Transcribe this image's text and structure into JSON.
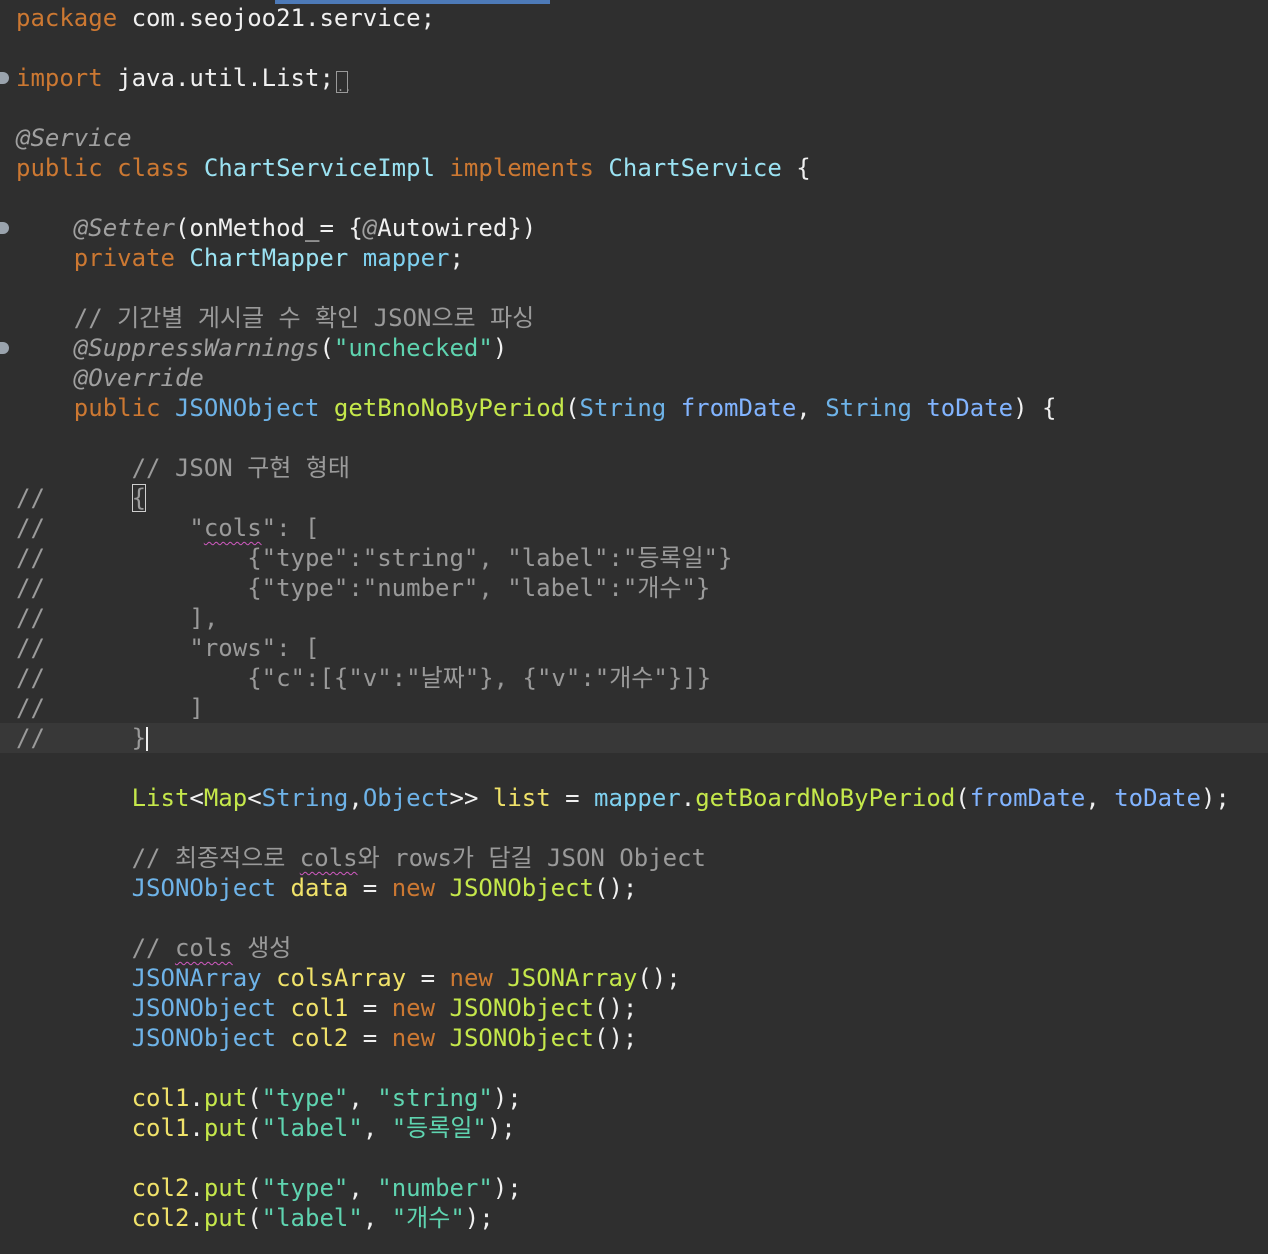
{
  "editor": {
    "language": "Java",
    "gutter_markers": [
      {
        "line": 3,
        "kind": "expand"
      },
      {
        "line": 8,
        "kind": "collapse"
      },
      {
        "line": 12,
        "kind": "collapse"
      }
    ],
    "lines": [
      [
        [
          "kw",
          "package"
        ],
        [
          "p",
          " com.seojoo21.service;"
        ]
      ],
      [],
      [
        [
          "kw",
          "import"
        ],
        [
          "p",
          " java.util.List;"
        ],
        [
          "fold",
          ".."
        ]
      ],
      [],
      [
        [
          "ann",
          "@Service"
        ]
      ],
      [
        [
          "kw",
          "public class "
        ],
        [
          "cls",
          "ChartServiceImpl"
        ],
        [
          "kw",
          " implements "
        ],
        [
          "cls",
          "ChartService"
        ],
        [
          "p",
          " {"
        ]
      ],
      [],
      [
        [
          "p",
          "    "
        ],
        [
          "ann",
          "@Setter"
        ],
        [
          "p",
          "(onMethod_= {"
        ],
        [
          "ann",
          "@"
        ],
        [
          "p",
          "Autowired})"
        ]
      ],
      [
        [
          "p",
          "    "
        ],
        [
          "kw",
          "private "
        ],
        [
          "cls",
          "ChartMapper"
        ],
        [
          "p",
          " "
        ],
        [
          "fld",
          "mapper"
        ],
        [
          "p",
          ";"
        ]
      ],
      [],
      [
        [
          "p",
          "    "
        ],
        [
          "cm",
          "// 기간별 게시글 수 확인 JSON으로 파싱"
        ]
      ],
      [
        [
          "p",
          "    "
        ],
        [
          "ann",
          "@SuppressWarnings"
        ],
        [
          "p",
          "("
        ],
        [
          "str",
          "\"unchecked\""
        ],
        [
          "p",
          ")"
        ]
      ],
      [
        [
          "p",
          "    "
        ],
        [
          "ann",
          "@Override"
        ]
      ],
      [
        [
          "p",
          "    "
        ],
        [
          "kw",
          "public "
        ],
        [
          "ty",
          "JSONObject"
        ],
        [
          "p",
          " "
        ],
        [
          "mth",
          "getBnoNoByPeriod"
        ],
        [
          "p",
          "("
        ],
        [
          "ty",
          "String"
        ],
        [
          "p",
          " "
        ],
        [
          "par",
          "fromDate"
        ],
        [
          "p",
          ", "
        ],
        [
          "ty",
          "String"
        ],
        [
          "p",
          " "
        ],
        [
          "par",
          "toDate"
        ],
        [
          "p",
          ") {"
        ]
      ],
      [],
      [
        [
          "p",
          "        "
        ],
        [
          "cm",
          "// JSON 구현 형태"
        ]
      ],
      [
        [
          "cm",
          "//      "
        ],
        [
          "cmbox",
          "{"
        ]
      ],
      [
        [
          "cm",
          "//          \""
        ],
        [
          "cmsq",
          "cols"
        ],
        [
          "cm",
          "\": ["
        ]
      ],
      [
        [
          "cm",
          "//              {\"type\":\"string\", \"label\":\"등록일\"}"
        ]
      ],
      [
        [
          "cm",
          "//              {\"type\":\"number\", \"label\":\"개수\"}"
        ]
      ],
      [
        [
          "cm",
          "//          ],"
        ]
      ],
      [
        [
          "cm",
          "//          \"rows\": ["
        ]
      ],
      [
        [
          "cm",
          "//              {\"c\":[{\"v\":\"날짜\"}, {\"v\":\"개수\"}]}"
        ]
      ],
      [
        [
          "cm",
          "//          ]"
        ]
      ],
      [
        [
          "cm",
          "//      }"
        ],
        [
          "caret",
          ""
        ]
      ],
      [],
      [
        [
          "p",
          "        "
        ],
        [
          "mth",
          "List"
        ],
        [
          "p",
          "<"
        ],
        [
          "mth",
          "Map"
        ],
        [
          "p",
          "<"
        ],
        [
          "ty",
          "String"
        ],
        [
          "p",
          ","
        ],
        [
          "ty",
          "Object"
        ],
        [
          "p",
          ">> "
        ],
        [
          "var",
          "list"
        ],
        [
          "p",
          " = "
        ],
        [
          "fld",
          "mapper"
        ],
        [
          "p",
          "."
        ],
        [
          "mth",
          "getBoardNoByPeriod"
        ],
        [
          "p",
          "("
        ],
        [
          "par",
          "fromDate"
        ],
        [
          "p",
          ", "
        ],
        [
          "par",
          "toDate"
        ],
        [
          "p",
          ");"
        ]
      ],
      [],
      [
        [
          "p",
          "        "
        ],
        [
          "cm",
          "// 최종적으로 "
        ],
        [
          "cmsq",
          "cols"
        ],
        [
          "cm",
          "와 rows가 담길 JSON Object"
        ]
      ],
      [
        [
          "p",
          "        "
        ],
        [
          "ty",
          "JSONObject"
        ],
        [
          "p",
          " "
        ],
        [
          "var",
          "data"
        ],
        [
          "p",
          " = "
        ],
        [
          "kw",
          "new "
        ],
        [
          "mth",
          "JSONObject"
        ],
        [
          "p",
          "();"
        ]
      ],
      [],
      [
        [
          "p",
          "        "
        ],
        [
          "cm",
          "// "
        ],
        [
          "cmsq",
          "cols"
        ],
        [
          "cm",
          " 생성"
        ]
      ],
      [
        [
          "p",
          "        "
        ],
        [
          "ty",
          "JSONArray"
        ],
        [
          "p",
          " "
        ],
        [
          "var",
          "colsArray"
        ],
        [
          "p",
          " = "
        ],
        [
          "kw",
          "new "
        ],
        [
          "mth",
          "JSONArray"
        ],
        [
          "p",
          "();"
        ]
      ],
      [
        [
          "p",
          "        "
        ],
        [
          "ty",
          "JSONObject"
        ],
        [
          "p",
          " "
        ],
        [
          "var",
          "col1"
        ],
        [
          "p",
          " = "
        ],
        [
          "kw",
          "new "
        ],
        [
          "mth",
          "JSONObject"
        ],
        [
          "p",
          "();"
        ]
      ],
      [
        [
          "p",
          "        "
        ],
        [
          "ty",
          "JSONObject"
        ],
        [
          "p",
          " "
        ],
        [
          "var",
          "col2"
        ],
        [
          "p",
          " = "
        ],
        [
          "kw",
          "new "
        ],
        [
          "mth",
          "JSONObject"
        ],
        [
          "p",
          "();"
        ]
      ],
      [],
      [
        [
          "p",
          "        "
        ],
        [
          "var",
          "col1"
        ],
        [
          "p",
          "."
        ],
        [
          "mth",
          "put"
        ],
        [
          "p",
          "("
        ],
        [
          "str",
          "\"type\""
        ],
        [
          "p",
          ", "
        ],
        [
          "str",
          "\"string\""
        ],
        [
          "p",
          ");"
        ]
      ],
      [
        [
          "p",
          "        "
        ],
        [
          "var",
          "col1"
        ],
        [
          "p",
          "."
        ],
        [
          "mth",
          "put"
        ],
        [
          "p",
          "("
        ],
        [
          "str",
          "\"label\""
        ],
        [
          "p",
          ", "
        ],
        [
          "str",
          "\"등록일\""
        ],
        [
          "p",
          ");"
        ]
      ],
      [],
      [
        [
          "p",
          "        "
        ],
        [
          "var",
          "col2"
        ],
        [
          "p",
          "."
        ],
        [
          "mth",
          "put"
        ],
        [
          "p",
          "("
        ],
        [
          "str",
          "\"type\""
        ],
        [
          "p",
          ", "
        ],
        [
          "str",
          "\"number\""
        ],
        [
          "p",
          ");"
        ]
      ],
      [
        [
          "p",
          "        "
        ],
        [
          "var",
          "col2"
        ],
        [
          "p",
          "."
        ],
        [
          "mth",
          "put"
        ],
        [
          "p",
          "("
        ],
        [
          "str",
          "\"label\""
        ],
        [
          "p",
          ", "
        ],
        [
          "str",
          "\"개수\""
        ],
        [
          "p",
          ");"
        ]
      ]
    ],
    "current_line": 25
  }
}
